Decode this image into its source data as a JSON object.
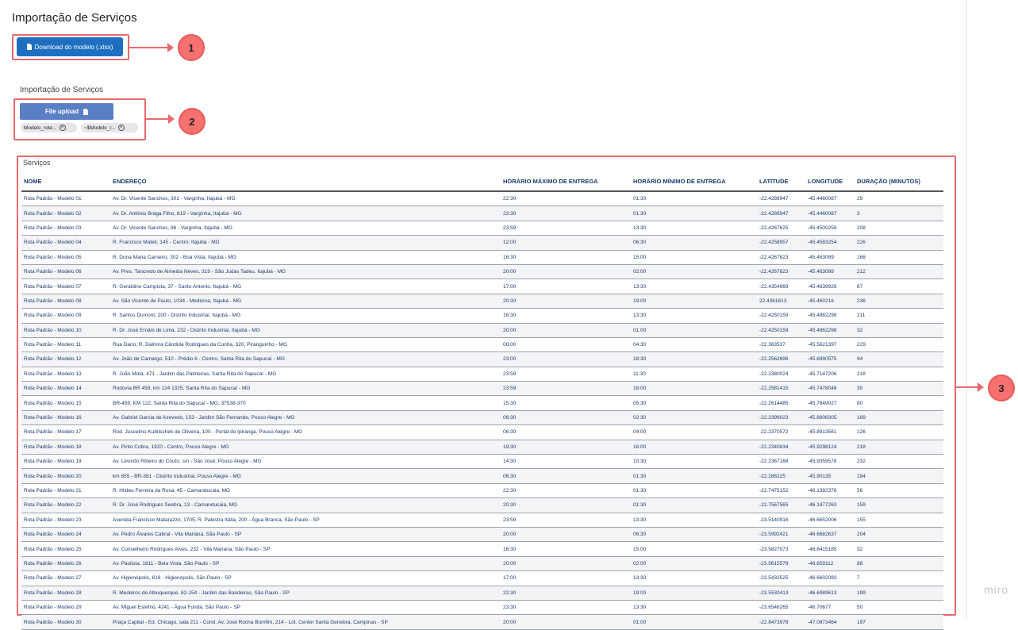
{
  "page": {
    "title": "Importação de Serviços"
  },
  "download": {
    "label": "Download do modelo (.xlsx)",
    "icon": "file-icon"
  },
  "upload": {
    "section_label": "Importação de Serviços",
    "button_label": "File upload",
    "files": [
      "Modelo_rote...",
      "~$Modelo_r..."
    ]
  },
  "callouts": [
    "1",
    "2",
    "3"
  ],
  "table": {
    "label": "Serviços",
    "headers": [
      "NOME",
      "ENDEREÇO",
      "HORÁRIO MÁXIMO DE ENTREGA",
      "HORÁRIO MÍNIMO DE ENTREGA",
      "LATITUDE",
      "LONGITUDE",
      "DURAÇÃO (MINUTOS)"
    ],
    "rows": [
      [
        "Rota Padrão - Modelo 01",
        "Av. Dr. Vicente Sanches, 301 - Varginha, Itajubá - MG",
        "22:30",
        "01:30",
        "-22.4288947",
        "-45.4460087",
        "29"
      ],
      [
        "Rota Padrão - Modelo 02",
        "Av. Dr. Antônio Braga Filho, 819 - Varginha, Itajubá - MG",
        "23:30",
        "01:30",
        "-22.4288947",
        "-45.4460087",
        "3"
      ],
      [
        "Rota Padrão - Modelo 03",
        "Av. Dr. Vicente Sanches, 86 - Varginha, Itajubá - MG",
        "23:59",
        "13:30",
        "-22.4267625",
        "-45.4500259",
        "208"
      ],
      [
        "Rota Padrão - Modelo 04",
        "R. Francisco Mateli, 145 - Centro, Itajubá - MG",
        "12:00",
        "06:30",
        "-22.4258957",
        "-45.4583254",
        "226"
      ],
      [
        "Rota Padrão - Modelo 05",
        "R. Dona Maria Carneiro, 302 - Boa Vista, Itajubá - MG",
        "16:30",
        "15:00",
        "-22.4267823",
        "-45.463089",
        "166"
      ],
      [
        "Rota Padrão - Modelo 06",
        "Av. Pres. Tancredo de Almeida Neves, 319 - São Judas Tadeu, Itajubá - MG",
        "20:00",
        "02:00",
        "-22.4267823",
        "-45.463089",
        "212"
      ],
      [
        "Rota Padrão - Modelo 07",
        "R. Geraldino Campista, 37 - Santo Antonio, Itajubá - MG",
        "17:00",
        "13:30",
        "-22.4354969",
        "-45.4639926",
        "87"
      ],
      [
        "Rota Padrão - Modelo 08",
        "Av. São Vicente de Paulo, 1034 - Medicina, Itajubá - MG",
        "20:30",
        "19:00",
        "22.4361613",
        "-45.460216",
        "236"
      ],
      [
        "Rota Padrão - Modelo 09",
        "R. Santos Dumont, 200 - Distrito Industrial, Itajubá - MG",
        "16:30",
        "13:30",
        "-22.4250159",
        "-45.4862298",
        "211"
      ],
      [
        "Rota Padrão - Modelo 10",
        "R. Dr. José Ernâni de Lima, 232 - Distrito Industrial, Itajubá - MG",
        "20:00",
        "01:00",
        "-22.4250159",
        "-45.4862298",
        "32"
      ],
      [
        "Rota Padrão - Modelo 11",
        "Rua Dario, R. Dalmira Cândida Rodrigues da Cunha, 320, Piranguinho - MG",
        "08:00",
        "04:30",
        "-22.363537",
        "-45.5621397",
        "229"
      ],
      [
        "Rota Padrão - Modelo 12",
        "Av. João de Camargo, 510 - Prédio 6 - Centro, Santa Rita do Sapucaí - MG",
        "23:00",
        "18:30",
        "-22.2562696",
        "-45.6990575",
        "94"
      ],
      [
        "Rota Padrão - Modelo 13",
        "R. João Mota, 471 - Jardim das Palmeiras, Santa Rita do Sapucaí - MG",
        "23:59",
        "11:30",
        "-22.2380024",
        "-45.7147206",
        "218"
      ],
      [
        "Rota Padrão - Modelo 14",
        "Rodovia BR 459, km 124 1325, Santa Rita do Sapucaí - MG",
        "23:59",
        "18:00",
        "-22.2581415",
        "-45.7478048",
        "30"
      ],
      [
        "Rota Padrão - Modelo 15",
        "BR-459, KM 122, Santa Rita do Sapucaí - MG, 37538-370",
        "15:30",
        "05:30",
        "-22.2614485",
        "-45.7649027",
        "80"
      ],
      [
        "Rota Padrão - Modelo 16",
        "Av. Gabriel Garcia de Azevedo, 153 - Jardim São Fernando, Pouso Alegre - MG",
        "06:30",
        "02:30",
        "-22.2399023",
        "-45.8806305",
        "189"
      ],
      [
        "Rota Padrão - Modelo 17",
        "Rod. Juscelino Kubitschek de Oliveira, 100 - Portal do Ipiranga, Pouso Alegre - MG",
        "06:30",
        "04:00",
        "-22.2370572",
        "-45.8913561",
        "126"
      ],
      [
        "Rota Padrão - Modelo 18",
        "Av. Pinto Cobra, 1920 - Centro, Pouso Alegre - MG",
        "19:30",
        "16:00",
        "-22.2340834",
        "-45.9298124",
        "218"
      ],
      [
        "Rota Padrão - Modelo 19",
        "Av. Levindo Ribeiro do Couto, s/n - São José, Pouso Alegre - MG",
        "14:30",
        "10:30",
        "-22.2367168",
        "-45.9359578",
        "232"
      ],
      [
        "Rota Padrão - Modelo 20",
        "km 855 - BR-381 - Distrito Industrial, Pouso Alegre - MG",
        "06:30",
        "01:30",
        "-22.288225",
        "-45.90135",
        "194"
      ],
      [
        "Rota Padrão - Modelo 21",
        "R. Hildeu Ferreira da Rosa, 45 - Camanducaia, MG",
        "22:30",
        "01:30",
        "-22.7475152",
        "-46.1392376",
        "56"
      ],
      [
        "Rota Padrão - Modelo 22",
        "R. Dr. José Rodrigues Seebra, 13 - Camanducaia, MG",
        "20:30",
        "01:30",
        "-22.7567565",
        "-46.1477263",
        "159"
      ],
      [
        "Rota Padrão - Modelo 23",
        "Avenida Francisco Matarazzo, 1705, R. Palestra Itália, 200 - Água Branca, São Paulo - SP",
        "23:59",
        "13:30",
        "-23.5140916",
        "-46.6652006",
        "155"
      ],
      [
        "Rota Padrão - Modelo 24",
        "Av. Pedro Álvares Cabral - Vila Mariana, São Paulo - SP",
        "20:00",
        "06:30",
        "-23.5992421",
        "-46.6682637",
        "204"
      ],
      [
        "Rota Padrão - Modelo 25",
        "Av. Conselheiro Rodrigues Alves, 232 - Vila Mariana, São Paulo - SP",
        "16:30",
        "15:00",
        "-23.5827073",
        "-46.6415185",
        "32"
      ],
      [
        "Rota Padrão - Modelo 26",
        "Av. Paulista, 1811 - Bela Vista, São Paulo - SP",
        "20:00",
        "02:00",
        "-23.5615579",
        "-46.659112",
        "88"
      ],
      [
        "Rota Padrão - Modelo 27",
        "Av. Higienópolis, 618 - Higienópolis, São Paulo - SP",
        "17:00",
        "13:30",
        "-23.5432525",
        "-46.6602093",
        "7"
      ],
      [
        "Rota Padrão - Modelo 28",
        "R. Medeiros de Albuquerque, 82-154 - Jardim das Bandeiras, São Paulo - SP",
        "22:30",
        "19:00",
        "-23.5530413",
        "-46.6989613",
        "199"
      ],
      [
        "Rota Padrão - Modelo 29",
        "Av. Miguel Estefno, 4241 - Água Funda, São Paulo - SP",
        "23:30",
        "13:30",
        "-23.6546265",
        "-46.70677",
        "50"
      ],
      [
        "Rota Padrão - Modelo 30",
        "Praça Capital - Ed. Chicago, sala 211 - Cond. Av. José Rocha Bomfim, 214 - Lot. Center Santa Genebra, Campinas - SP",
        "20:00",
        "01:00",
        "-22.8473978",
        "-47.0873464",
        "197"
      ]
    ]
  },
  "watermark": "miro"
}
